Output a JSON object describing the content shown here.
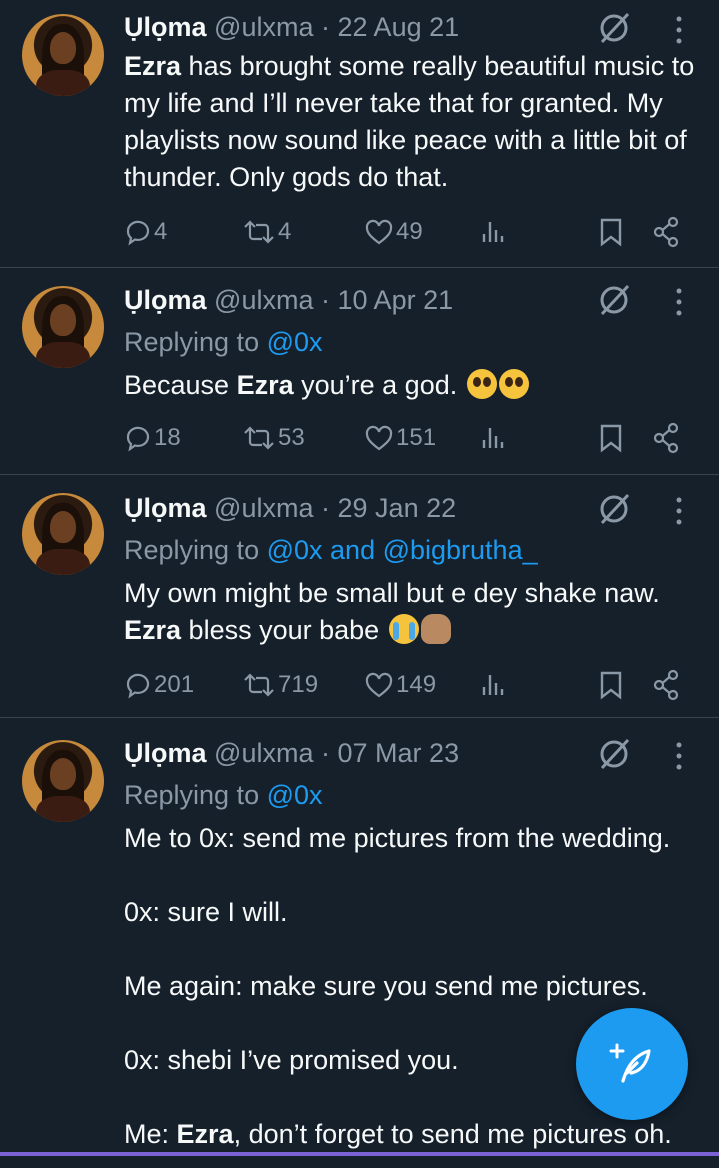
{
  "tweets": [
    {
      "name": "Ụlọma",
      "handle": "@ulxma",
      "separator": "·",
      "date": "22 Aug 21",
      "replying": null,
      "text_html": "<b>Ezra</b> has brought some really beautiful music to my life and I’ll never take that for granted. My playlists now sound like peace with a little bit of thunder. Only gods do that.",
      "replies": "4",
      "retweets": "4",
      "likes": "49"
    },
    {
      "name": "Ụlọma",
      "handle": "@ulxma",
      "separator": "·",
      "date": "10 Apr 21",
      "replying_prefix": "Replying to",
      "replying_to": "@0x",
      "text_html": "Because <b>Ezra</b> you’re a god. <span class=\"emoji plead\"></span><span class=\"emoji plead\"></span>",
      "replies": "18",
      "retweets": "53",
      "likes": "151"
    },
    {
      "name": "Ụlọma",
      "handle": "@ulxma",
      "separator": "·",
      "date": "29 Jan 22",
      "replying_prefix": "Replying to",
      "replying_to": "@0x and @bigbrutha_",
      "text_html": "My own might be small but e dey shake naw. <b>Ezra</b> bless your babe <span class=\"emoji cry\"></span><span class=\"emoji hands\"></span>",
      "replies": "201",
      "retweets": "719",
      "likes": "149"
    },
    {
      "name": "Ụlọma",
      "handle": "@ulxma",
      "separator": "·",
      "date": "07 Mar 23",
      "replying_prefix": "Replying to",
      "replying_to": "@0x",
      "text_html": "Me to 0x: send me pictures from the wedding.<br><br>0x: sure I will.<br><br>Me again: make sure you send me pictures.<br><br>0x: shebi I’ve promised you.<br><br>Me: <b>Ezra</b>, don’t forget to send me pictures oh."
    }
  ],
  "icons": {
    "reply": "reply-icon",
    "retweet": "retweet-icon",
    "like": "heart-icon",
    "views": "views-icon",
    "bookmark": "bookmark-icon",
    "share": "share-icon",
    "grok": "grok-icon",
    "more": "more-icon",
    "compose": "compose-icon"
  },
  "colors": {
    "background": "#15202b",
    "accent": "#1d9bf0",
    "muted": "#8b98a5"
  }
}
